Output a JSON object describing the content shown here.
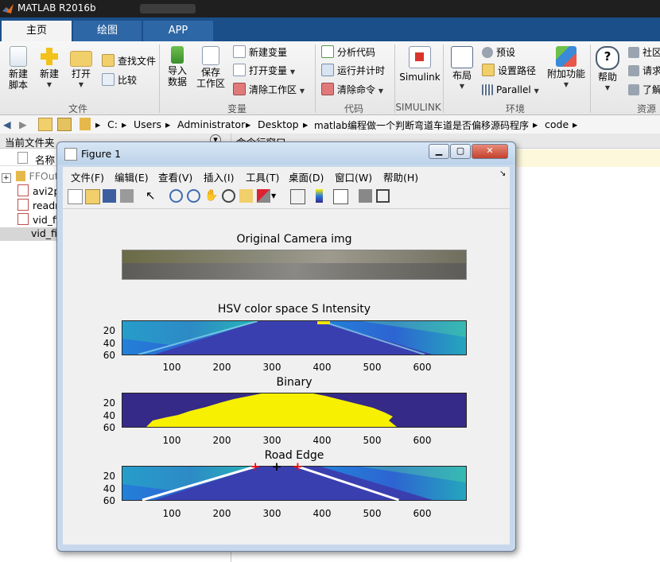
{
  "window": {
    "title": "MATLAB R2016b"
  },
  "tabs": [
    {
      "label": "主页",
      "active": true
    },
    {
      "label": "绘图",
      "active": false
    },
    {
      "label": "APP",
      "active": false
    }
  ],
  "ribbon": {
    "file_group": {
      "label": "文件",
      "new_script": "新建\n脚本",
      "new_script_l1": "新建",
      "new_script_l2": "脚本",
      "new": "新建",
      "open": "打开",
      "find_files": "查找文件",
      "compare": "比较"
    },
    "variable_group": {
      "label": "变量",
      "import_l1": "导入",
      "import_l2": "数据",
      "save_l1": "保存",
      "save_l2": "工作区",
      "new_variable": "新建变量",
      "open_variable": "打开变量",
      "clear_workspace": "清除工作区"
    },
    "code_group": {
      "label": "代码",
      "analyze": "分析代码",
      "run_time": "运行并计时",
      "clear_commands": "清除命令"
    },
    "simulink_group": {
      "label": "SIMULINK",
      "simulink": "Simulink"
    },
    "env_group": {
      "label": "环境",
      "layout": "布局",
      "preferences": "预设",
      "set_path": "设置路径",
      "parallel": "Parallel",
      "addons": "附加功能"
    },
    "resources_group": {
      "label": "资源",
      "help": "帮助",
      "community": "社区",
      "request": "请求",
      "learn": "了解"
    }
  },
  "address": {
    "crumbs": [
      "C:",
      "Users",
      "Administrator",
      "Desktop",
      "matlab编程做一个判断弯道车道是否偏移源码程序",
      "code"
    ]
  },
  "current_folder": {
    "title": "当前文件夹",
    "column_name": "名称",
    "files": [
      "FFOut",
      "avi2p",
      "readr",
      "vid_fi",
      "vid_fi"
    ]
  },
  "command_window": {
    "title": "命令行窗口"
  },
  "figure": {
    "title": "Figure 1",
    "menu": [
      "文件(F)",
      "编辑(E)",
      "查看(V)",
      "插入(I)",
      "工具(T)",
      "桌面(D)",
      "窗口(W)",
      "帮助(H)"
    ],
    "toolbar_icons": [
      "new-figure-icon",
      "open-file-icon",
      "save-icon",
      "print-icon",
      "pointer-icon",
      "zoom-in-icon",
      "zoom-out-icon",
      "pan-icon",
      "rotate-icon",
      "data-cursor-icon",
      "brush-icon",
      "link-icon",
      "colorbar-icon",
      "legend-icon",
      "hide-plot-tools-icon",
      "show-plot-tools-icon"
    ],
    "subplots": [
      {
        "title": "Original Camera img",
        "type": "image"
      },
      {
        "title": "HSV color space S Intensity",
        "yticks": [
          "20",
          "40",
          "60"
        ],
        "xticks": [
          "100",
          "200",
          "300",
          "400",
          "500",
          "600"
        ]
      },
      {
        "title": "Binary",
        "yticks": [
          "20",
          "40",
          "60"
        ],
        "xticks": [
          "100",
          "200",
          "300",
          "400",
          "500",
          "600"
        ]
      },
      {
        "title": "Road Edge",
        "yticks": [
          "20",
          "40",
          "60"
        ],
        "xticks": [
          "100",
          "200",
          "300",
          "400",
          "500",
          "600"
        ]
      }
    ]
  },
  "chart_data": [
    {
      "type": "heatmap",
      "title": "Original Camera img",
      "xlabel": "",
      "ylabel": ""
    },
    {
      "type": "heatmap",
      "title": "HSV color space S Intensity",
      "xlabel": "",
      "ylabel": "",
      "xlim": [
        0,
        690
      ],
      "ylim": [
        60,
        0
      ],
      "xticks": [
        100,
        200,
        300,
        400,
        500,
        600
      ],
      "yticks": [
        20,
        40,
        60
      ]
    },
    {
      "type": "heatmap",
      "title": "Binary",
      "xlabel": "",
      "ylabel": "",
      "xlim": [
        0,
        690
      ],
      "ylim": [
        60,
        0
      ],
      "xticks": [
        100,
        200,
        300,
        400,
        500,
        600
      ],
      "yticks": [
        20,
        40,
        60
      ],
      "colors": {
        "foreground": "#f7f000",
        "background": "#352a87"
      }
    },
    {
      "type": "line",
      "title": "Road Edge",
      "xlabel": "",
      "ylabel": "",
      "xlim": [
        0,
        690
      ],
      "ylim": [
        60,
        0
      ],
      "xticks": [
        100,
        200,
        300,
        400,
        500,
        600
      ],
      "yticks": [
        20,
        40,
        60
      ],
      "series": [
        {
          "x": [
            40,
            267
          ],
          "y": [
            60,
            0
          ],
          "color": "#ffffff"
        },
        {
          "x": [
            352,
            555
          ],
          "y": [
            0,
            60
          ],
          "color": "#ffffff"
        }
      ],
      "markers": [
        {
          "x": 267,
          "y": 0,
          "color": "#ff0000",
          "symbol": "+"
        },
        {
          "x": 310,
          "y": 0,
          "color": "#000000",
          "symbol": "+"
        },
        {
          "x": 352,
          "y": 0,
          "color": "#ff0000",
          "symbol": "+"
        }
      ]
    }
  ]
}
